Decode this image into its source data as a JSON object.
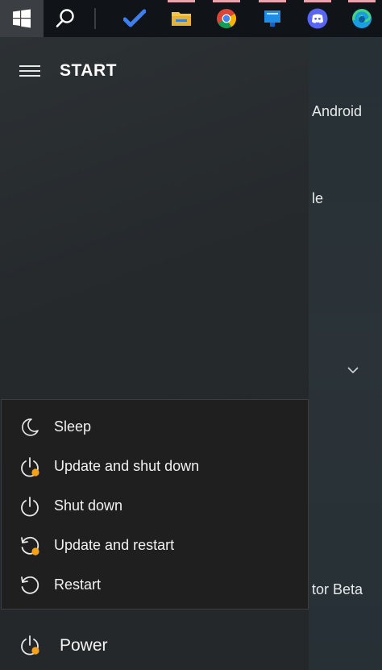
{
  "taskbar": {
    "start_icon": "windows-logo-icon",
    "search_icon": "search-icon",
    "pinned_apps": [
      {
        "name": "todo-app-icon",
        "color": "#2f6fdf"
      },
      {
        "name": "file-explorer-icon",
        "color": "#f2c94c"
      },
      {
        "name": "chrome-icon",
        "color": "#e94235"
      },
      {
        "name": "app-window-icon",
        "color": "#1e90ff"
      },
      {
        "name": "discord-icon",
        "color": "#5865f2"
      },
      {
        "name": "edge-icon",
        "color": "#2ec4b6"
      }
    ]
  },
  "start_menu": {
    "title": "START"
  },
  "background": {
    "text1": "Android",
    "text2": "le",
    "text3": "tor Beta"
  },
  "power_menu": {
    "items": [
      {
        "label": "Sleep",
        "icon": "moon-icon"
      },
      {
        "label": "Update and shut down",
        "icon": "power-update-icon"
      },
      {
        "label": "Shut down",
        "icon": "power-icon"
      },
      {
        "label": "Update and restart",
        "icon": "restart-update-icon"
      },
      {
        "label": "Restart",
        "icon": "restart-icon"
      }
    ],
    "power_label": "Power",
    "badge_color": "#f5a11a"
  }
}
